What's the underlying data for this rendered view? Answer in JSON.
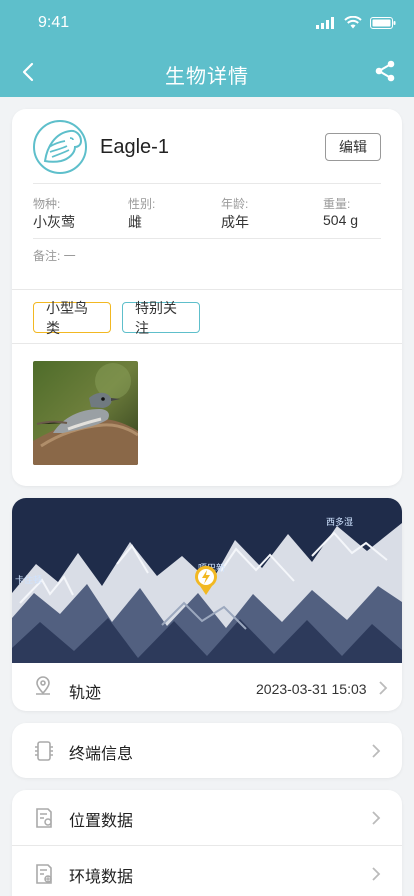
{
  "status_bar": {
    "time": "9:41"
  },
  "nav": {
    "title": "生物详情"
  },
  "profile": {
    "name": "Eagle-1",
    "edit_label": "编辑",
    "attributes": [
      {
        "label": "物种:",
        "value": "小灰莺"
      },
      {
        "label": "性别:",
        "value": "雌"
      },
      {
        "label": "年龄:",
        "value": "成年"
      },
      {
        "label": "重量:",
        "value": "504 g"
      }
    ],
    "note": "备注: 一",
    "tags": [
      "小型鸟类",
      "特别关注"
    ]
  },
  "map": {
    "labels": [
      "卡住顿",
      "嘎巴新",
      "西多湿"
    ],
    "track_label": "轨迹",
    "track_time": "2023-03-31 15:03"
  },
  "rows": {
    "terminal": "终端信息",
    "location": "位置数据",
    "environment": "环境数据"
  },
  "colors": {
    "header": "#5ebfcb",
    "tag_yellow": "#f2b822",
    "tag_teal": "#5ebfcb",
    "marker": "#f2b822"
  },
  "icons": {
    "back": "back-icon",
    "share": "share-icon",
    "marker": "lightning-marker-icon",
    "track": "location-pin-icon",
    "terminal": "device-icon",
    "location": "document-location-icon",
    "environment": "document-environment-icon"
  }
}
